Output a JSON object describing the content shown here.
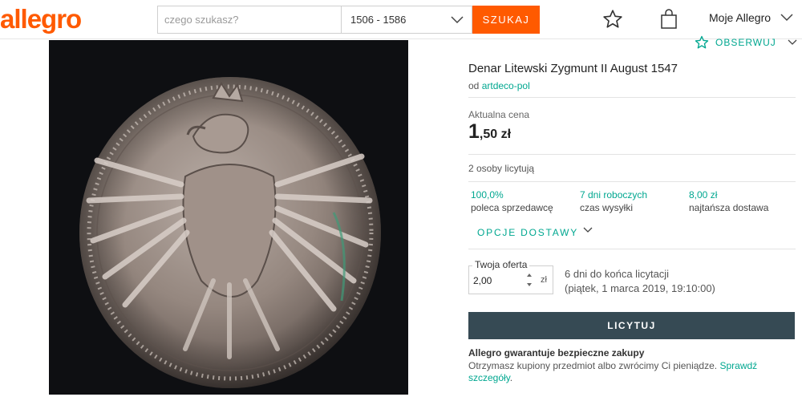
{
  "header": {
    "logo": "allegro",
    "search_placeholder": "czego szukasz?",
    "category_value": "1506 - 1586",
    "search_button": "SZUKAJ",
    "account_label": "Moje Allegro"
  },
  "listing": {
    "observe_label": "OBSERWUJ",
    "title": "Denar Litewski Zygmunt II August 1547",
    "seller_prefix": "od",
    "seller_name": "artdeco-pol",
    "price_label": "Aktualna cena",
    "price_main": "1",
    "price_fraction": ",50 zł",
    "bidders": "2 osoby licytują",
    "stats": [
      {
        "value": "100,0%",
        "label": "poleca sprzedawcę"
      },
      {
        "value": "7 dni roboczych",
        "label": "czas wysyłki"
      },
      {
        "value": "8,00 zł",
        "label": "najtańsza dostawa"
      }
    ],
    "delivery_options": "OPCJE DOSTAWY"
  },
  "bid": {
    "legend": "Twoja oferta",
    "value": "2,00",
    "currency": "zł",
    "ends_line1": "6 dni do końca licytacji",
    "ends_line2": "(piątek, 1 marca 2019, 19:10:00)",
    "button": "LICYTUJ"
  },
  "guarantee": {
    "title": "Allegro gwarantuje bezpieczne zakupy",
    "text": "Otrzymasz kupiony przedmiot albo zwrócimy Ci pieniądze.",
    "link": "Sprawdź szczegóły",
    "end": "."
  },
  "colors": {
    "brand": "#ff5a00",
    "accent": "#00a790",
    "bid_button": "#364a54"
  }
}
